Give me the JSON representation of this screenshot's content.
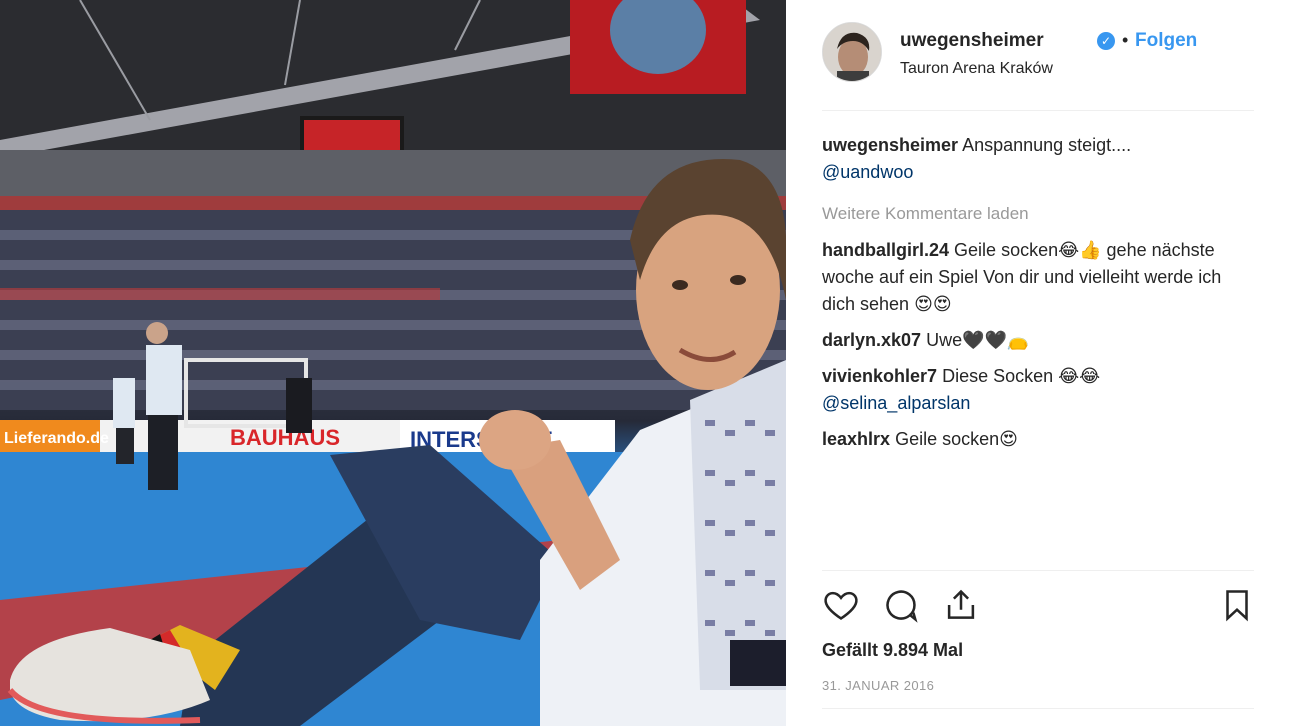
{
  "photo": {
    "banners": [
      "Lieferando.de",
      "BAUHAUS",
      "INTERSPORT"
    ],
    "alt": ""
  },
  "post": {
    "author": {
      "username": "uwegensheimer",
      "verified": true,
      "follow_label": "Folgen",
      "separator": "•",
      "location": "Tauron Arena Kraków"
    },
    "caption": {
      "username": "uwegensheimer",
      "text": "Anspannung steigt....",
      "mention": "@uandwoo"
    },
    "load_more_label": "Weitere Kommentare laden",
    "comments": [
      {
        "username": "handballgirl.24",
        "text": "Geile socken😂👍 gehe nächste woche auf ein Spiel Von dir und vielleiht werde ich dich sehen 😍😍",
        "mention": ""
      },
      {
        "username": "darlyn.xk07",
        "text": "Uwe🖤🖤👝",
        "mention": ""
      },
      {
        "username": "vivienkohler7",
        "text": "Diese Socken 😂😂",
        "mention": "@selina_alparslan"
      },
      {
        "username": "leaxhlrx",
        "text": "Geile socken😍",
        "mention": ""
      }
    ],
    "likes_label": "Gefällt 9.894 Mal",
    "date_label": "31. JANUAR 2016",
    "icons": [
      "heart-icon",
      "comment-icon",
      "share-icon",
      "bookmark-icon"
    ],
    "colors": {
      "accent": "#3897f0",
      "mention": "#003569",
      "muted": "#999999"
    }
  }
}
